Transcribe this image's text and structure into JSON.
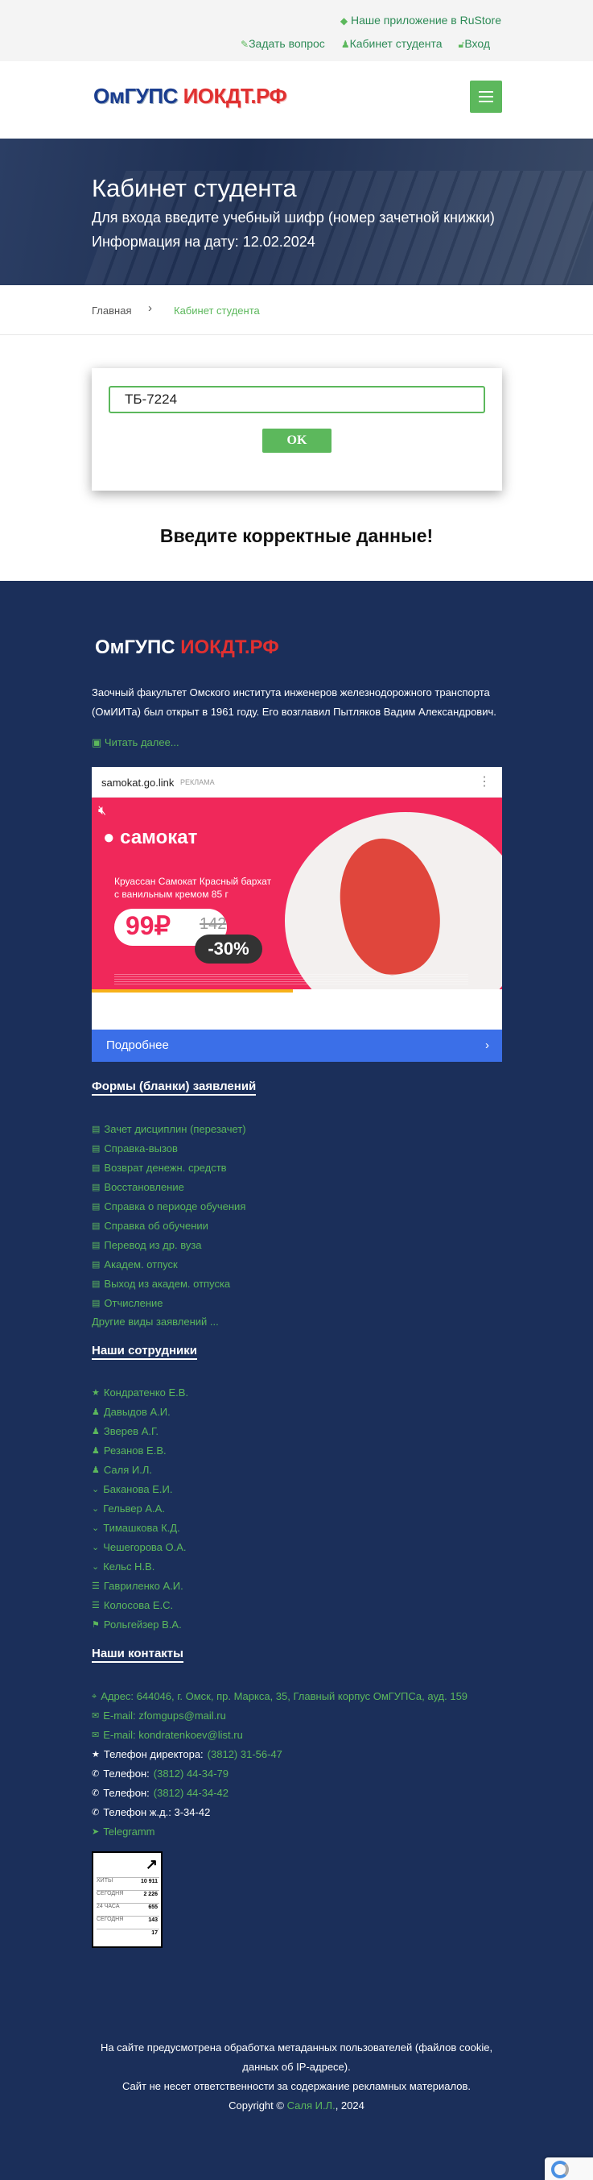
{
  "topbar": {
    "rustore": "Наше приложение в RuStore",
    "ask": "Задать вопрос",
    "cabinet": "Кабинет студента",
    "login": "Вход"
  },
  "logo": {
    "left": "ОмГУПС",
    "right": "ИОКДТ.РФ"
  },
  "hero": {
    "title": "Кабинет студента",
    "subtitle": "Для входа введите учебный шифр (номер зачетной книжки)",
    "date_line": "Информация на дату: 12.02.2024"
  },
  "breadcrumb": {
    "home": "Главная",
    "separator": "›",
    "current": "Кабинет студента"
  },
  "form": {
    "cipher_value": "ТБ-7224",
    "ok_label": "OK"
  },
  "error_message": "Введите корректные данные!",
  "footer": {
    "logo_left": "ОмГУПС",
    "logo_right": "ИОКДТ.РФ",
    "description": "Заочный факультет Омского института инженеров железнодорожного транспорта (ОмИИТа) был открыт в 1961 году. Его возглавил Пытляков Вадим Александрович.",
    "read_more": "Читать далее...",
    "ad": {
      "domain": "samokat.go.link",
      "ad_label": "РЕКЛАМА",
      "brand": "самокат",
      "product": "Круассан Самокат Красный бархат с ванильным кремом 85 г",
      "price_new": "99₽",
      "price_old": "142",
      "discount": "-30%",
      "more": "Подробнее",
      "progress": 0.49
    },
    "forms_title": "Формы (бланки) заявлений",
    "forms": [
      "Зачет дисциплин (перезачет)",
      "Справка-вызов",
      "Возврат денежн. средств",
      "Восстановление",
      "Справка о периоде обучения",
      "Справка об обучении",
      "Перевод из др. вуза",
      "Академ. отпуск",
      "Выход из академ. отпуска",
      "Отчисление"
    ],
    "forms_other": "Другие виды заявлений ...",
    "staff_title": "Наши сотрудники",
    "staff": [
      {
        "name": "Кондратенко Е.В.",
        "icon": "★"
      },
      {
        "name": "Давыдов А.И.",
        "icon": "♟"
      },
      {
        "name": "Зверев А.Г.",
        "icon": "♟"
      },
      {
        "name": "Резанов Е.В.",
        "icon": "♟"
      },
      {
        "name": "Саля И.Л.",
        "icon": "♟"
      },
      {
        "name": "Баканова Е.И.",
        "icon": "⌄"
      },
      {
        "name": "Гельвер А.А.",
        "icon": "⌄"
      },
      {
        "name": "Тимашкова К.Д.",
        "icon": "⌄"
      },
      {
        "name": "Чешегорова О.А.",
        "icon": "⌄"
      },
      {
        "name": "Кельс Н.В.",
        "icon": "⌄"
      },
      {
        "name": "Гавриленко А.И.",
        "icon": "☰"
      },
      {
        "name": "Колосова Е.С.",
        "icon": "☰"
      },
      {
        "name": "Рольгейзер В.А.",
        "icon": "⚑"
      }
    ],
    "contacts_title": "Наши контакты",
    "contacts": {
      "address": "Адрес: 644046, г. Омск, пр. Маркса, 35, Главный корпус ОмГУПСа, ауд. 159",
      "email1": "E-mail: zfomgups@mail.ru",
      "email2": "E-mail: kondratenkoev@list.ru",
      "director_label": "Телефон директора:",
      "director_phone": "(3812) 31-56-47",
      "phone1_label": "Телефон:",
      "phone1": "(3812) 44-34-79",
      "phone2_label": "Телефон:",
      "phone2": "(3812) 44-34-42",
      "phone_rail": "Телефон ж.д.: 3-34-42",
      "telegram": "Telegramm"
    },
    "counter": [
      {
        "label": "ХИТЫ",
        "value": "10 911"
      },
      {
        "label": "СЕГОДНЯ",
        "value": "2 226"
      },
      {
        "label": "24 ЧАСА",
        "value": "655"
      },
      {
        "label": "СЕГОДНЯ",
        "value": "143"
      },
      {
        "label": "",
        "value": "17"
      }
    ],
    "note_line1": "На сайте предусмотрена обработка метаданных пользователей (файлов cookie,",
    "note_line2": "данных об IP-адресе).",
    "note_line3": "Сайт не несет ответственности за содержание рекламных материалов.",
    "copyright_prefix": "Copyright ©",
    "copyright_name": "Саля И.Л.",
    "copyright_suffix": ", 2024"
  },
  "colors": {
    "accent": "#5cb85c",
    "footer_bg": "#1b2f5a",
    "hero_bg": "#2b3e64",
    "logo_blue": "#1a3d8f",
    "logo_red": "#e03030"
  }
}
